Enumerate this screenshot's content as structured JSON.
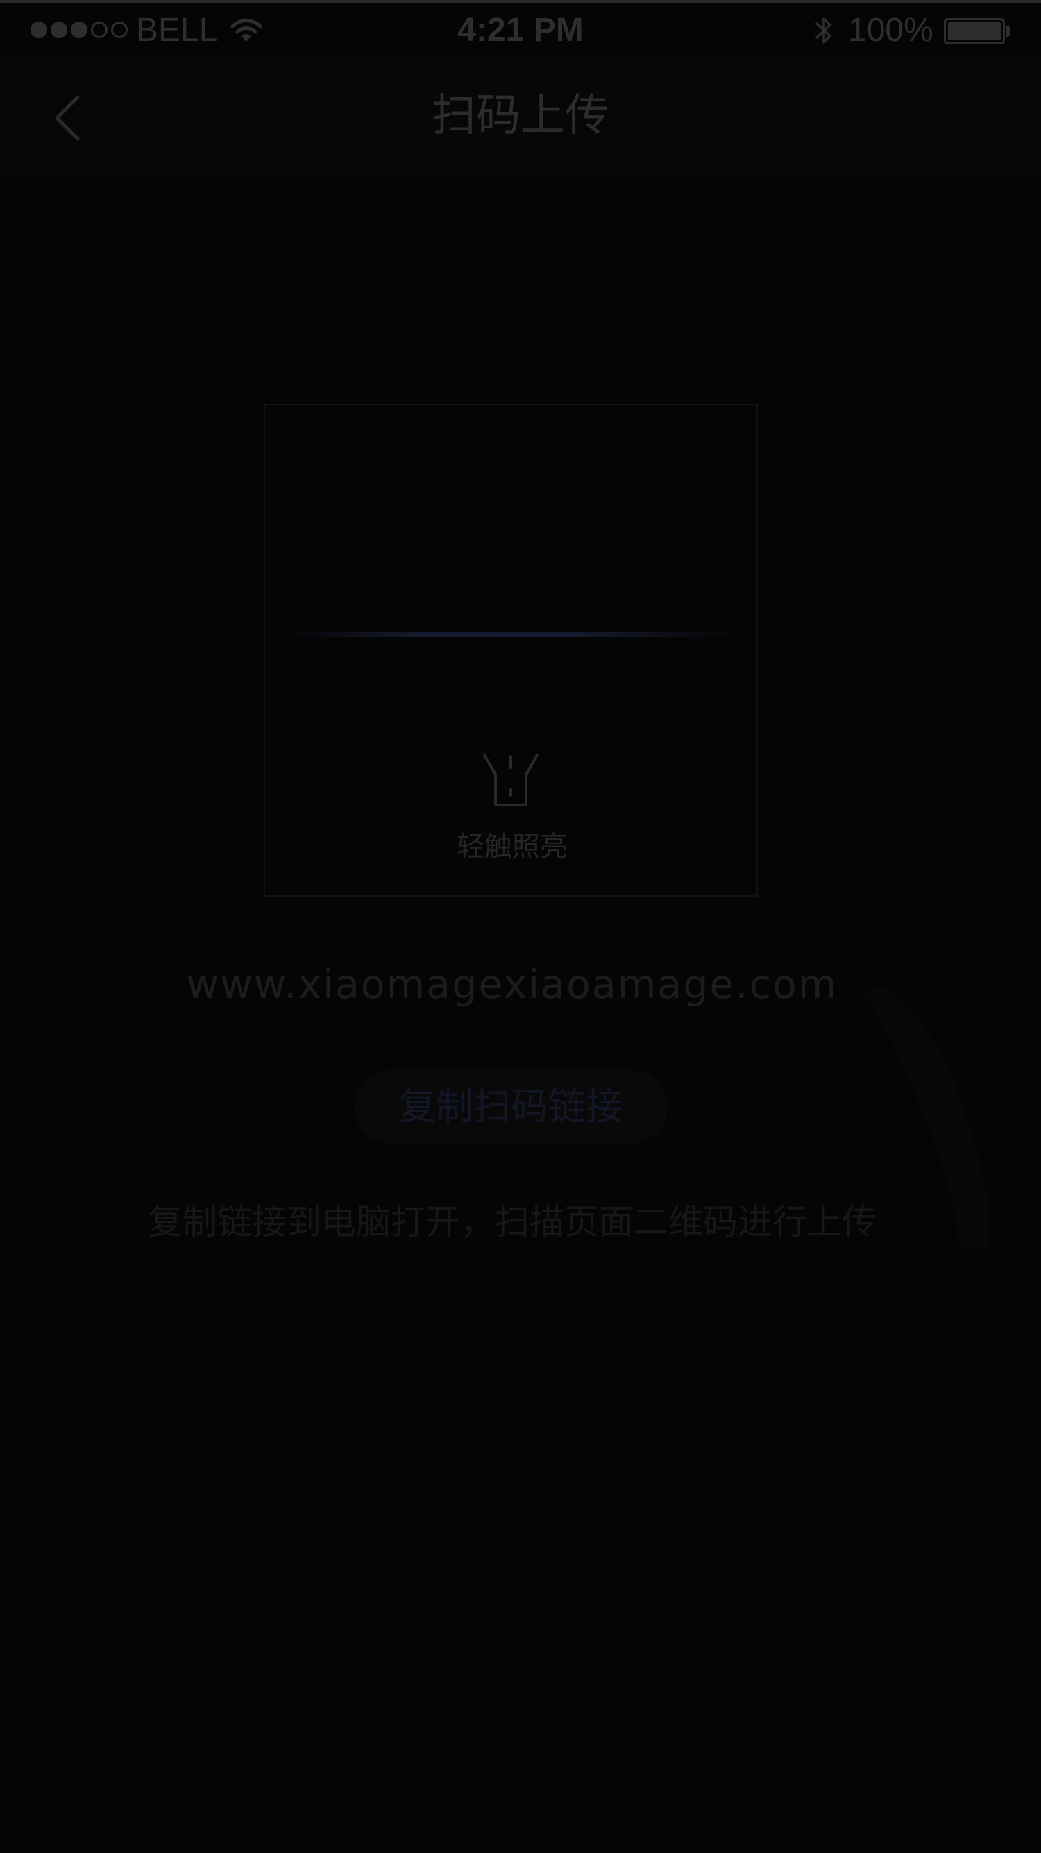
{
  "status_bar": {
    "signal_bars_filled": 3,
    "signal_bars_total": 5,
    "carrier": "BELL",
    "wifi_icon": "wifi-icon",
    "time": "4:21 PM",
    "bluetooth_icon": "bluetooth-icon",
    "battery_percent": "100%",
    "battery_level": 1.0
  },
  "nav": {
    "back_icon": "chevron-left-icon",
    "title": "扫码上传"
  },
  "scanner": {
    "torch_icon": "flashlight-icon",
    "torch_label": "轻触照亮"
  },
  "content": {
    "url": "www.xiaomagexiaoamage.com",
    "copy_button_label": "复制扫码链接",
    "hint": "复制链接到电脑打开，扫描页面二维码进行上传"
  },
  "colors": {
    "background": "#050505",
    "scan_accent": "#161a2e",
    "text_dim": "#2c2c2c"
  }
}
